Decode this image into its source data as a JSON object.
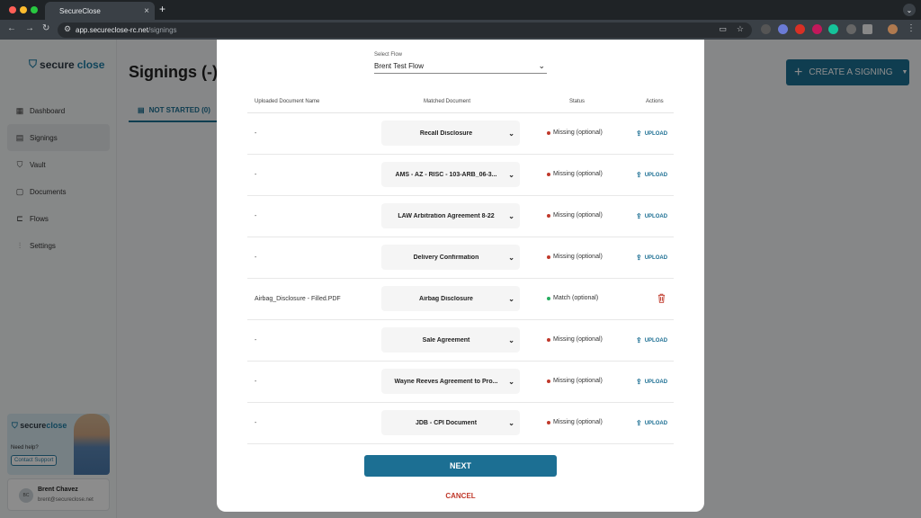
{
  "browser": {
    "tab_title": "SecureClose",
    "tab_close": "×",
    "new_tab": "+",
    "url_host": "app.secureclose-rc.net",
    "url_path": "/signings"
  },
  "sidebar": {
    "logo_secure": "secure",
    "logo_close": "close",
    "items": [
      {
        "label": "Dashboard",
        "icon": "dashboard-icon",
        "active": false
      },
      {
        "label": "Signings",
        "icon": "signings-icon",
        "active": true
      },
      {
        "label": "Vault",
        "icon": "shield-icon",
        "active": false
      },
      {
        "label": "Documents",
        "icon": "documents-icon",
        "active": false
      },
      {
        "label": "Flows",
        "icon": "flows-icon",
        "active": false
      },
      {
        "label": "Settings",
        "icon": "sliders-icon",
        "active": false
      }
    ],
    "support": {
      "logo_secure": "secure",
      "logo_close": "close",
      "help_text": "Need help?",
      "contact_label": "Contact Support"
    },
    "user": {
      "initials": "BC",
      "name": "Brent Chavez",
      "email": "brent@secureclose.net"
    }
  },
  "main": {
    "title": "Signings (-)",
    "tab_label": "NOT STARTED (0)",
    "create_label": "CREATE A SIGNING"
  },
  "modal": {
    "flow_label": "Select Flow",
    "flow_value": "Brent Test Flow",
    "columns": {
      "uploaded": "Uploaded Document Name",
      "matched": "Matched Document",
      "status": "Status",
      "actions": "Actions"
    },
    "rows": [
      {
        "uploaded": "-",
        "matched": "Recall Disclosure",
        "status": "Missing (optional)",
        "state": "missing",
        "action": "UPLOAD"
      },
      {
        "uploaded": "-",
        "matched": "AMS - AZ - RISC - 103-ARB_06-3...",
        "status": "Missing (optional)",
        "state": "missing",
        "action": "UPLOAD"
      },
      {
        "uploaded": "-",
        "matched": "LAW Arbitration Agreement 8-22",
        "status": "Missing (optional)",
        "state": "missing",
        "action": "UPLOAD"
      },
      {
        "uploaded": "-",
        "matched": "Delivery Confirmation",
        "status": "Missing (optional)",
        "state": "missing",
        "action": "UPLOAD"
      },
      {
        "uploaded": "Airbag_Disclosure - Filled.PDF",
        "matched": "Airbag Disclosure",
        "status": "Match (optional)",
        "state": "match",
        "action": ""
      },
      {
        "uploaded": "-",
        "matched": "Sale Agreement",
        "status": "Missing (optional)",
        "state": "missing",
        "action": "UPLOAD"
      },
      {
        "uploaded": "-",
        "matched": "Wayne Reeves Agreement to Pro...",
        "status": "Missing (optional)",
        "state": "missing",
        "action": "UPLOAD"
      },
      {
        "uploaded": "-",
        "matched": "JDB - CPI Document",
        "status": "Missing (optional)",
        "state": "missing",
        "action": "UPLOAD"
      }
    ],
    "next_label": "NEXT",
    "cancel_label": "CANCEL"
  },
  "colors": {
    "primary": "#1c6f93",
    "danger": "#c0392b",
    "success": "#27ae60"
  }
}
